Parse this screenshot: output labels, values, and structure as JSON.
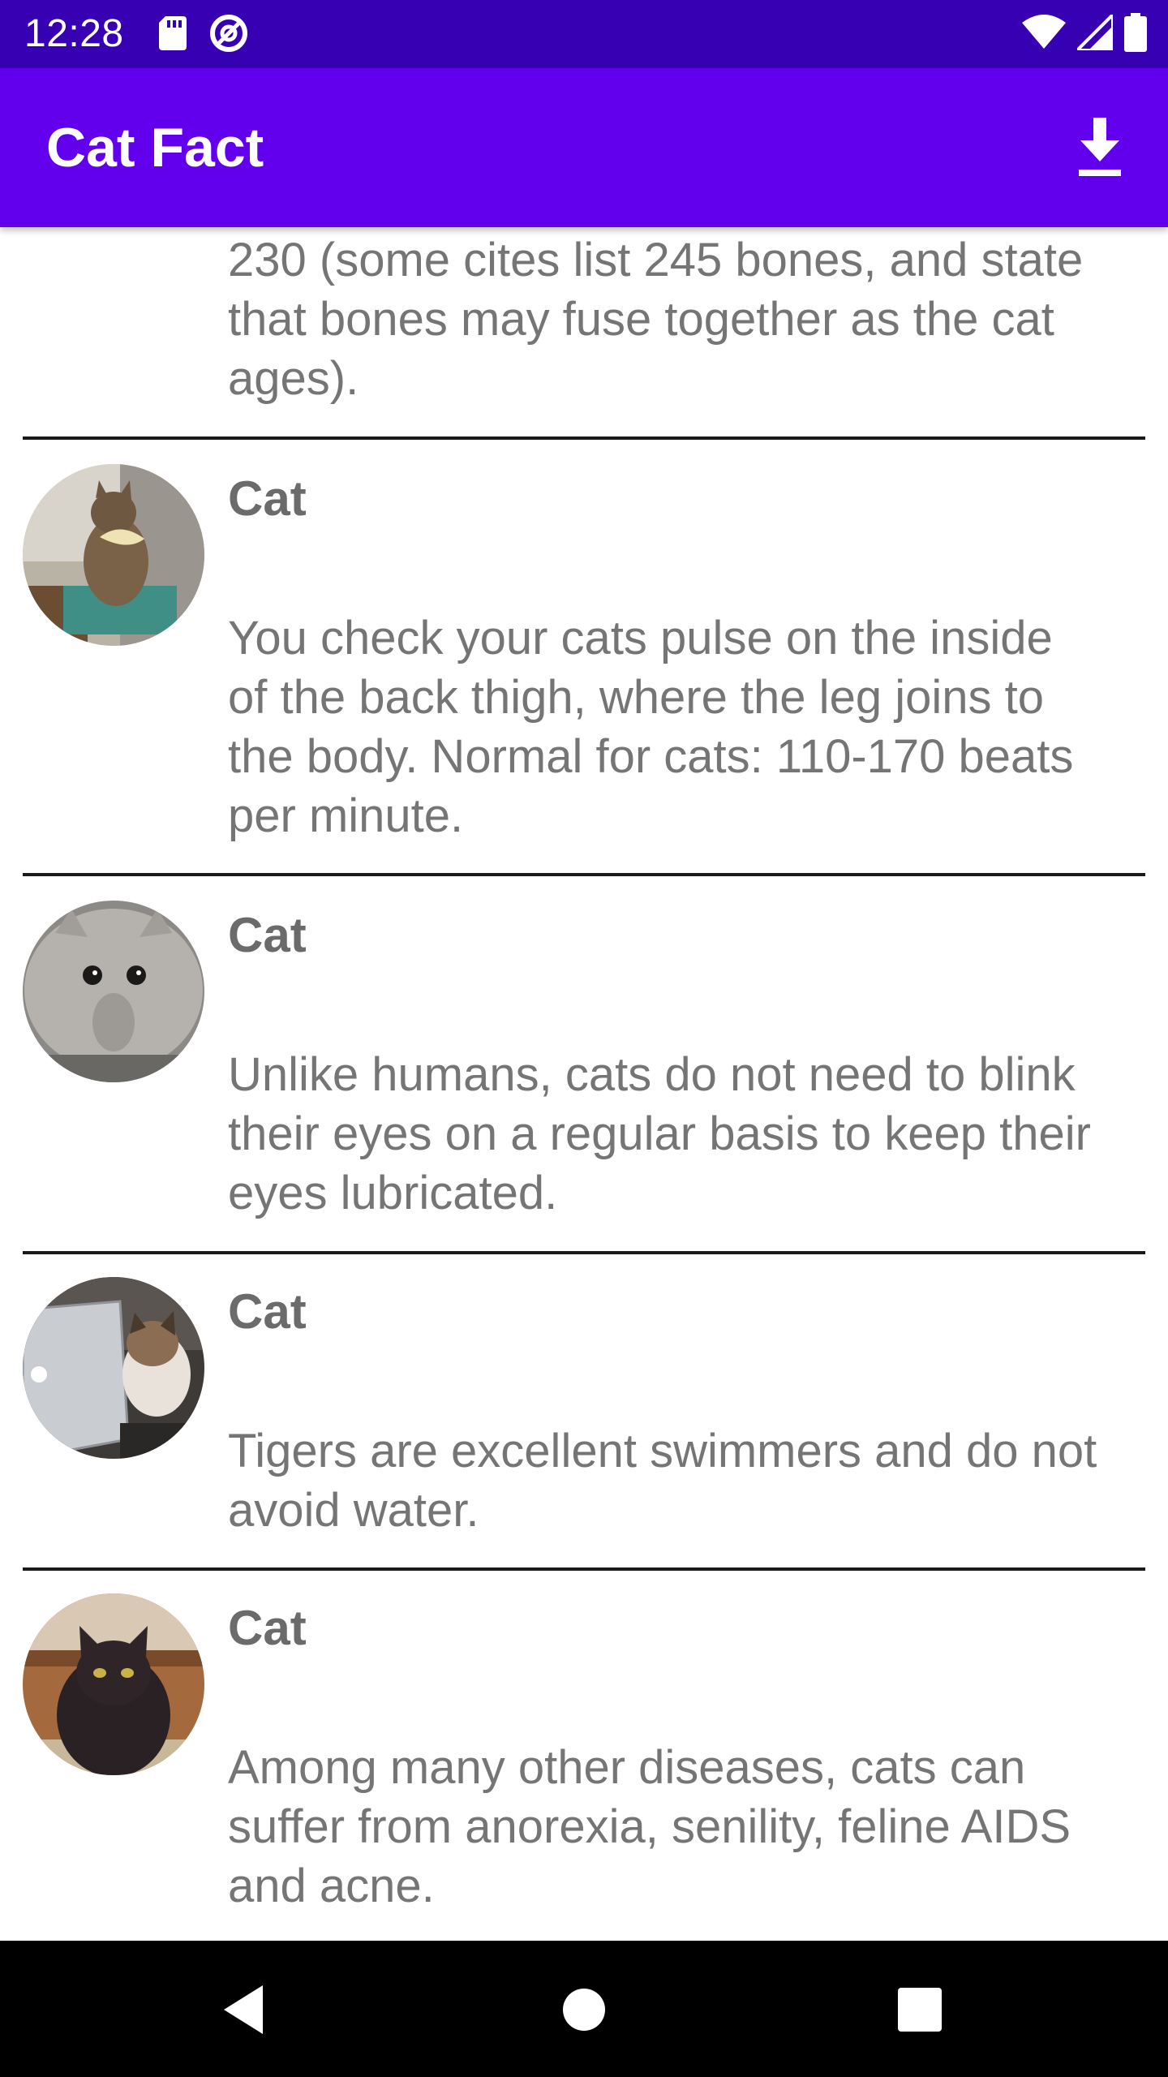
{
  "status_bar": {
    "time": "12:28",
    "left_icons": [
      "sd-card-icon",
      "at-sign-icon"
    ],
    "right_icons": [
      "wifi-icon",
      "signal-icon",
      "battery-icon"
    ]
  },
  "app_bar": {
    "title": "Cat Fact",
    "action_icon": "download-icon",
    "background": "#6200ee"
  },
  "status_bar_color": "#3700b3",
  "list": {
    "partial_item_text": "230 (some cites list 245 bones, and state that bones may fuse together as the cat ages).",
    "items": [
      {
        "name": "Cat",
        "fact": "You check your cats pulse on the inside of the back thigh, where the leg joins to the body. Normal for cats: 110-170 beats per minute.",
        "avatar": "cat-with-bow-photo"
      },
      {
        "name": "Cat",
        "fact": "Unlike humans, cats do not need to blink their eyes on a regular basis to keep their eyes lubricated.",
        "avatar": "grey-fluffy-cat-photo"
      },
      {
        "name": "Cat",
        "fact": "Tigers are excellent swimmers and do not avoid water.",
        "avatar": "cat-with-laptop-photo"
      },
      {
        "name": "Cat",
        "fact": "Among many other diseases, cats can suffer from anorexia, senility, feline AIDS and acne.",
        "avatar": "black-longhair-cat-photo"
      }
    ]
  },
  "nav_bar": {
    "buttons": [
      "back-icon",
      "home-icon",
      "recents-icon"
    ]
  }
}
